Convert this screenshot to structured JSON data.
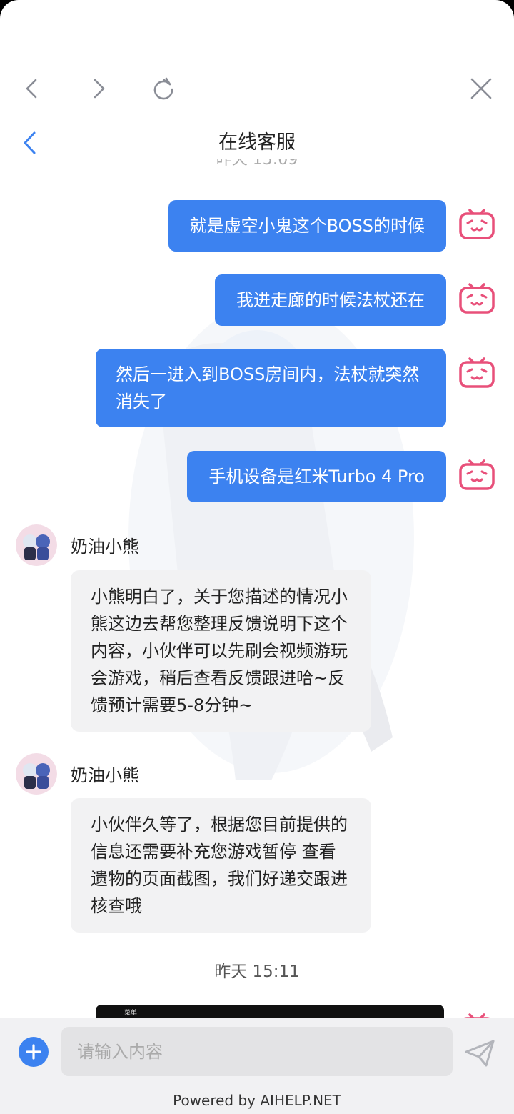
{
  "header": {
    "title": "在线客服"
  },
  "chat": {
    "clipped_timestamp": "昨天 15:09",
    "user_messages": [
      "就是虚空小鬼这个BOSS的时候",
      "我进走廊的时候法杖还在",
      "然后一进入到BOSS房间内，法杖就突然消失了",
      "手机设备是红米Turbo 4 Pro"
    ],
    "agent_messages": [
      {
        "name": "奶油小熊",
        "text": "小熊明白了，关于您描述的情况小熊这边去帮您整理反馈说明下这个内容，小伙伴可以先刷会视频游玩会游戏，稍后查看反馈跟进哈~反馈预计需要5-8分钟~"
      },
      {
        "name": "奶油小熊",
        "text": "小伙伴久等了，根据您目前提供的信息还需要补充您游戏暂停 查看遗物的页面截图，我们好递交跟进核查哦"
      }
    ],
    "timestamp": "昨天 15:11",
    "image_preview_label": "菜单"
  },
  "footer": {
    "input_placeholder": "请输入内容",
    "input_value": "",
    "powered_by": "Powered by AIHELP.NET"
  },
  "colors": {
    "accent": "#3c82f0",
    "user_avatar": "#e8507a",
    "agent_bubble": "#f2f2f3",
    "footer_bg": "#f1f1f3"
  },
  "icons": [
    "back-arrow-icon",
    "forward-arrow-icon",
    "reload-icon",
    "close-icon",
    "bilibili-tv-icon",
    "plus-icon",
    "send-icon"
  ]
}
